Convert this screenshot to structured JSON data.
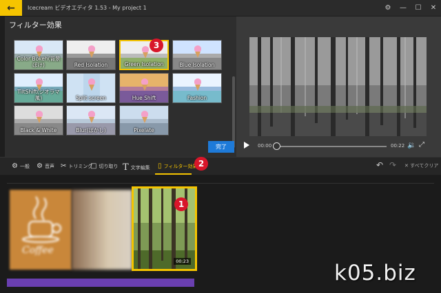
{
  "titlebar": {
    "back_icon": "arrow-left-icon",
    "title": "Icecream ビデオエディタ 1.53  -  My project 1",
    "controls": [
      "gear-icon",
      "minimize-icon",
      "maximize-icon",
      "close-icon"
    ]
  },
  "filter_panel": {
    "title": "フィルター効果",
    "done_label": "完了",
    "filters": [
      {
        "label": "Color Bokeh(背景ぼけ)"
      },
      {
        "label": "Red Isolation"
      },
      {
        "label": "Green Isolation"
      },
      {
        "label": "Blue Isolation"
      },
      {
        "label": "TiltShift(ジオラマ風)"
      },
      {
        "label": "Split screen"
      },
      {
        "label": "Hue Shift"
      },
      {
        "label": "Fashion"
      },
      {
        "label": "Black & White"
      },
      {
        "label": "Blur(ぼかし)"
      },
      {
        "label": "Pixelate"
      }
    ],
    "selected_filter": "Green Isolation"
  },
  "player": {
    "current_time": "00:00",
    "duration": "00:22",
    "progress": 0
  },
  "toolbar": {
    "tools": [
      {
        "label": "一般",
        "icon": "gear-icon"
      },
      {
        "label": "音声",
        "icon": "audio-gear-icon"
      },
      {
        "label": "トリミング",
        "icon": "scissors-icon"
      },
      {
        "label": "切り取り",
        "icon": "crop-icon"
      },
      {
        "label": "文字編集",
        "icon": "text-icon"
      },
      {
        "label": "フィルター効果",
        "icon": "filter-icon"
      }
    ],
    "active_tool": "フィルター効果",
    "clear_label": "すべてクリア"
  },
  "timeline": {
    "selected_clip_duration": "00:23",
    "coffee_text": "Coffee"
  },
  "badges": [
    "1",
    "2",
    "3"
  ],
  "watermark": "k05.biz",
  "colors": {
    "accent": "#f5c400",
    "primary_button": "#1e7ad8",
    "badge": "#d8162a",
    "audio_track": "#6a3fb0"
  }
}
